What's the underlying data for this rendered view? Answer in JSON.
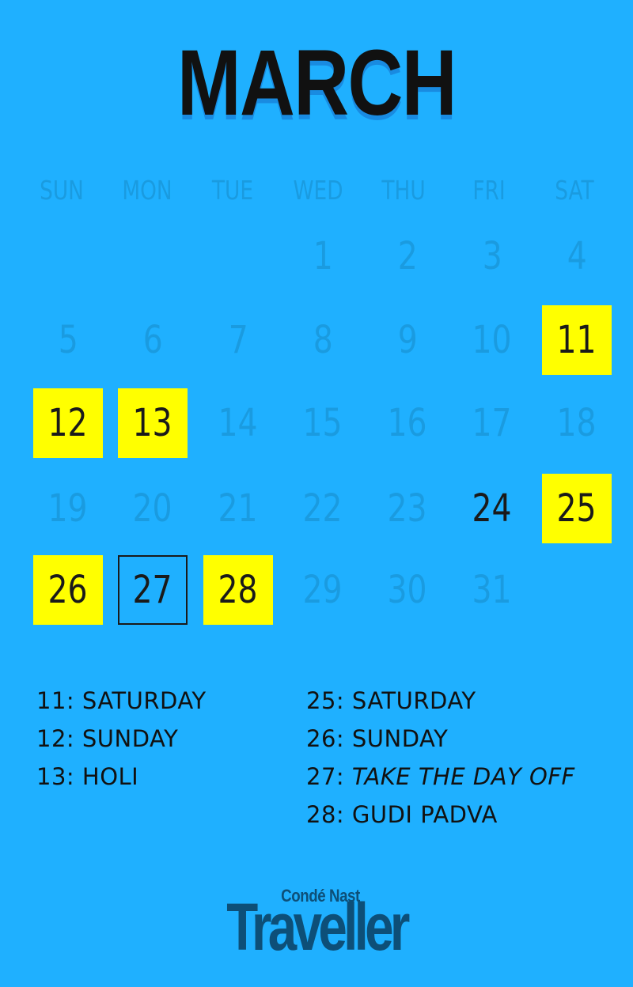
{
  "calendar": {
    "month": "MARCH",
    "weekdays": [
      "SUN",
      "MON",
      "TUE",
      "WED",
      "THU",
      "FRI",
      "SAT"
    ],
    "days": [
      {
        "n": "1",
        "style": "plain"
      },
      {
        "n": "2",
        "style": "plain"
      },
      {
        "n": "3",
        "style": "plain"
      },
      {
        "n": "4",
        "style": "plain"
      },
      {
        "n": "5",
        "style": "plain"
      },
      {
        "n": "6",
        "style": "plain"
      },
      {
        "n": "7",
        "style": "plain"
      },
      {
        "n": "8",
        "style": "plain"
      },
      {
        "n": "9",
        "style": "plain"
      },
      {
        "n": "10",
        "style": "plain"
      },
      {
        "n": "11",
        "style": "highlight"
      },
      {
        "n": "12",
        "style": "highlight"
      },
      {
        "n": "13",
        "style": "highlight"
      },
      {
        "n": "14",
        "style": "plain"
      },
      {
        "n": "15",
        "style": "plain"
      },
      {
        "n": "16",
        "style": "plain"
      },
      {
        "n": "17",
        "style": "plain"
      },
      {
        "n": "18",
        "style": "plain"
      },
      {
        "n": "19",
        "style": "plain"
      },
      {
        "n": "20",
        "style": "plain"
      },
      {
        "n": "21",
        "style": "plain"
      },
      {
        "n": "22",
        "style": "plain"
      },
      {
        "n": "23",
        "style": "plain"
      },
      {
        "n": "24",
        "style": "dark"
      },
      {
        "n": "25",
        "style": "highlight"
      },
      {
        "n": "26",
        "style": "highlight"
      },
      {
        "n": "27",
        "style": "boxed"
      },
      {
        "n": "28",
        "style": "highlight"
      },
      {
        "n": "29",
        "style": "plain"
      },
      {
        "n": "30",
        "style": "plain"
      },
      {
        "n": "31",
        "style": "plain"
      }
    ]
  },
  "notes": {
    "left": [
      {
        "prefix": "11: ",
        "text": "SATURDAY"
      },
      {
        "prefix": "12: ",
        "text": "SUNDAY"
      },
      {
        "prefix": "13: ",
        "text": "HOLI"
      }
    ],
    "right": [
      {
        "prefix": "25: ",
        "text": "SATURDAY"
      },
      {
        "prefix": "26: ",
        "text": "SUNDAY"
      },
      {
        "prefix": "27: ",
        "text": "TAKE THE DAY OFF",
        "italic": true
      },
      {
        "prefix": "28: ",
        "text": "GUDI PADVA"
      }
    ]
  },
  "logo": {
    "small": "Condé Nast",
    "big": "Traveller"
  },
  "colors": {
    "background": "#1fb0ff",
    "highlight": "#ffff00",
    "muted_text": "#1a9be0",
    "dark_text": "#1a1a1a",
    "logo": "#0d4f78"
  }
}
